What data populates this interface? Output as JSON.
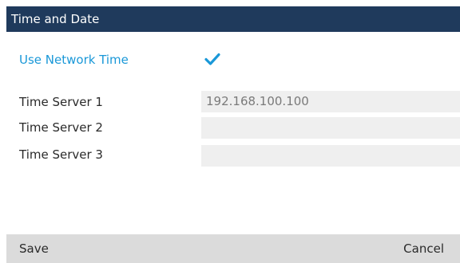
{
  "screen": {
    "title": "Time and Date"
  },
  "settings": {
    "use_network_time": {
      "label": "Use Network Time",
      "checked": true
    },
    "servers": [
      {
        "label": "Time Server 1",
        "value": "192.168.100.100"
      },
      {
        "label": "Time Server 2",
        "value": ""
      },
      {
        "label": "Time Server 3",
        "value": ""
      }
    ]
  },
  "softkeys": {
    "left": "Save",
    "right": "Cancel"
  },
  "colors": {
    "title_bar": "#1f3a5c",
    "accent": "#1a98d8",
    "field_bg": "#efefef",
    "footer_bg": "#dbdbdb"
  },
  "icons": {
    "checkbox": "checkmark-icon"
  }
}
